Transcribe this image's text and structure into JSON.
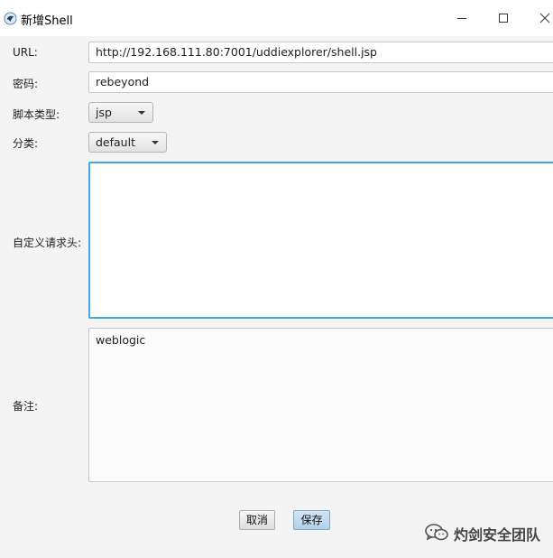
{
  "window": {
    "title": "新增Shell",
    "controls": {
      "minimize": "minimize-icon",
      "maximize": "maximize-icon",
      "close": "close-icon"
    }
  },
  "form": {
    "url": {
      "label": "URL:",
      "value": "http://192.168.111.80:7001/uddiexplorer/shell.jsp"
    },
    "password": {
      "label": "密码:",
      "value": "rebeyond"
    },
    "script_type": {
      "label": "脚本类型:",
      "selected": "jsp"
    },
    "category": {
      "label": "分类:",
      "selected": "default"
    },
    "custom_headers": {
      "label": "自定义请求头:",
      "value": ""
    },
    "notes": {
      "label": "备注:",
      "value": "weblogic"
    }
  },
  "buttons": {
    "cancel": "取消",
    "save": "保存"
  },
  "watermark": {
    "text": "灼剑安全团队",
    "icon": "wechat-icon"
  },
  "colors": {
    "focus_border": "#3ea7e9",
    "window_bg": "#f4f4f4",
    "save_button": "#b3d1ea"
  }
}
